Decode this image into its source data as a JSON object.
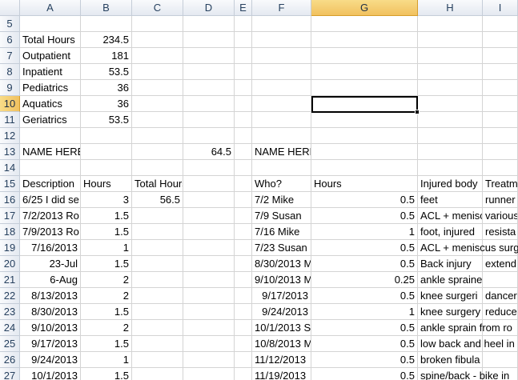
{
  "spreadsheet": {
    "columns": [
      "A",
      "B",
      "C",
      "D",
      "E",
      "F",
      "G",
      "H",
      "I"
    ],
    "selected_column": "G",
    "rows": [
      5,
      6,
      7,
      8,
      9,
      10,
      11,
      12,
      13,
      14,
      15,
      16,
      17,
      18,
      19,
      20,
      21,
      22,
      23,
      24,
      25,
      26,
      27
    ],
    "selected_row": 10,
    "cells": [
      {
        "ref": "A6",
        "value": "Total Hours"
      },
      {
        "ref": "B6",
        "value": "234.5"
      },
      {
        "ref": "A7",
        "value": "Outpatient"
      },
      {
        "ref": "B7",
        "value": "181"
      },
      {
        "ref": "A8",
        "value": "Inpatient"
      },
      {
        "ref": "B8",
        "value": "53.5"
      },
      {
        "ref": "A9",
        "value": "Pediatrics"
      },
      {
        "ref": "B9",
        "value": "36"
      },
      {
        "ref": "A10",
        "value": "Aquatics"
      },
      {
        "ref": "B10",
        "value": "36"
      },
      {
        "ref": "A11",
        "value": "Geriatrics"
      },
      {
        "ref": "B11",
        "value": "53.5"
      },
      {
        "ref": "A13",
        "value": "NAME HERE"
      },
      {
        "ref": "D13",
        "value": "64.5"
      },
      {
        "ref": "F13",
        "value": "NAME HERE"
      },
      {
        "ref": "A15",
        "value": "Description"
      },
      {
        "ref": "B15",
        "value": "Hours"
      },
      {
        "ref": "C15",
        "value": "Total Hours"
      },
      {
        "ref": "F15",
        "value": "Who?"
      },
      {
        "ref": "G15",
        "value": "Hours"
      },
      {
        "ref": "H15",
        "value": "Injured body"
      },
      {
        "ref": "I15",
        "value": "Treatm"
      },
      {
        "ref": "A16",
        "value": "6/25 I did se"
      },
      {
        "ref": "B16",
        "value": "3"
      },
      {
        "ref": "C16",
        "value": "56.5"
      },
      {
        "ref": "F16",
        "value": "7/2 Mike"
      },
      {
        "ref": "G16",
        "value": "0.5"
      },
      {
        "ref": "H16",
        "value": "feet"
      },
      {
        "ref": "I16",
        "value": "runner"
      },
      {
        "ref": "A17",
        "value": "7/2/2013 Ro"
      },
      {
        "ref": "B17",
        "value": "1.5"
      },
      {
        "ref": "F17",
        "value": "7/9 Susan"
      },
      {
        "ref": "G17",
        "value": "0.5"
      },
      {
        "ref": "H17",
        "value": "ACL + menisc"
      },
      {
        "ref": "I17",
        "value": "various"
      },
      {
        "ref": "A18",
        "value": "7/9/2013 Ro"
      },
      {
        "ref": "B18",
        "value": "1.5"
      },
      {
        "ref": "F18",
        "value": "7/16 Mike"
      },
      {
        "ref": "G18",
        "value": "1"
      },
      {
        "ref": "H18",
        "value": "foot, injured"
      },
      {
        "ref": "I18",
        "value": "resista"
      },
      {
        "ref": "A19",
        "value": "7/16/2013"
      },
      {
        "ref": "B19",
        "value": "1"
      },
      {
        "ref": "F19",
        "value": "7/23 Susan"
      },
      {
        "ref": "G19",
        "value": "0.5"
      },
      {
        "ref": "H19",
        "value": "ACL + meniscus surg"
      },
      {
        "ref": "A20",
        "value": "23-Jul"
      },
      {
        "ref": "B20",
        "value": "1.5"
      },
      {
        "ref": "F20",
        "value": "8/30/2013 M"
      },
      {
        "ref": "G20",
        "value": "0.5"
      },
      {
        "ref": "H20",
        "value": "Back injury"
      },
      {
        "ref": "I20",
        "value": "extend"
      },
      {
        "ref": "A21",
        "value": "6-Aug"
      },
      {
        "ref": "B21",
        "value": "2"
      },
      {
        "ref": "F21",
        "value": "9/10/2013 M"
      },
      {
        "ref": "G21",
        "value": "0.25"
      },
      {
        "ref": "H21",
        "value": "ankle sprained"
      },
      {
        "ref": "A22",
        "value": "8/13/2013"
      },
      {
        "ref": "B22",
        "value": "2"
      },
      {
        "ref": "F22",
        "value": "9/17/2013"
      },
      {
        "ref": "G22",
        "value": "0.5"
      },
      {
        "ref": "H22",
        "value": "knee surgeri"
      },
      {
        "ref": "I22",
        "value": "dancer"
      },
      {
        "ref": "A23",
        "value": "8/30/2013"
      },
      {
        "ref": "B23",
        "value": "1.5"
      },
      {
        "ref": "F23",
        "value": "9/24/2013"
      },
      {
        "ref": "G23",
        "value": "1"
      },
      {
        "ref": "H23",
        "value": "knee surgery"
      },
      {
        "ref": "I23",
        "value": "reduce"
      },
      {
        "ref": "A24",
        "value": "9/10/2013"
      },
      {
        "ref": "B24",
        "value": "2"
      },
      {
        "ref": "F24",
        "value": "10/1/2013 S"
      },
      {
        "ref": "G24",
        "value": "0.5"
      },
      {
        "ref": "H24",
        "value": "ankle sprain from ro"
      },
      {
        "ref": "A25",
        "value": "9/17/2013"
      },
      {
        "ref": "B25",
        "value": "1.5"
      },
      {
        "ref": "F25",
        "value": "10/8/2013 M"
      },
      {
        "ref": "G25",
        "value": "0.5"
      },
      {
        "ref": "H25",
        "value": "low back and heel in"
      },
      {
        "ref": "A26",
        "value": "9/24/2013"
      },
      {
        "ref": "B26",
        "value": "1"
      },
      {
        "ref": "F26",
        "value": "11/12/2013"
      },
      {
        "ref": "G26",
        "value": "0.5"
      },
      {
        "ref": "H26",
        "value": "broken fibula"
      },
      {
        "ref": "A27",
        "value": "10/1/2013"
      },
      {
        "ref": "B27",
        "value": "1.5"
      },
      {
        "ref": "F27",
        "value": "11/19/2013"
      },
      {
        "ref": "G27",
        "value": "0.5"
      },
      {
        "ref": "H27",
        "value": "spine/back - bike in"
      }
    ],
    "right_aligned_cells": [
      "B6",
      "B7",
      "B8",
      "B9",
      "B10",
      "B11",
      "D13",
      "C16",
      "B16",
      "B17",
      "B18",
      "B19",
      "B20",
      "B21",
      "B22",
      "B23",
      "B24",
      "B25",
      "B26",
      "B27",
      "A19",
      "A20",
      "A21",
      "A22",
      "A23",
      "A24",
      "A25",
      "A26",
      "A27",
      "G16",
      "G17",
      "G18",
      "G19",
      "G20",
      "G21",
      "G22",
      "G23",
      "G24",
      "G25",
      "G26",
      "G27",
      "F22",
      "F23"
    ],
    "overflow_cells": [
      "H19",
      "H24",
      "H25",
      "H27"
    ],
    "active_cell": "G10",
    "colors": {
      "header_selected": "#f1c15f",
      "header_text": "#27415f",
      "gridline": "#d4d4d4"
    }
  }
}
